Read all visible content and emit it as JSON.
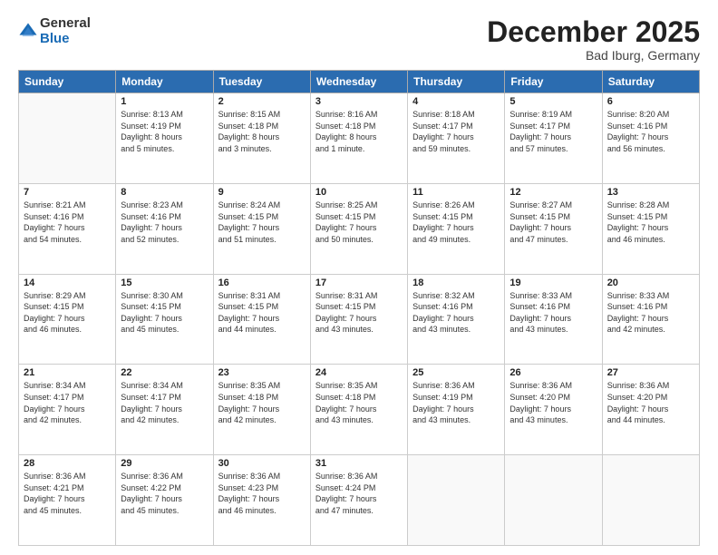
{
  "header": {
    "logo_general": "General",
    "logo_blue": "Blue",
    "month_title": "December 2025",
    "subtitle": "Bad Iburg, Germany"
  },
  "days_of_week": [
    "Sunday",
    "Monday",
    "Tuesday",
    "Wednesday",
    "Thursday",
    "Friday",
    "Saturday"
  ],
  "weeks": [
    [
      {
        "day": "",
        "info": ""
      },
      {
        "day": "1",
        "info": "Sunrise: 8:13 AM\nSunset: 4:19 PM\nDaylight: 8 hours\nand 5 minutes."
      },
      {
        "day": "2",
        "info": "Sunrise: 8:15 AM\nSunset: 4:18 PM\nDaylight: 8 hours\nand 3 minutes."
      },
      {
        "day": "3",
        "info": "Sunrise: 8:16 AM\nSunset: 4:18 PM\nDaylight: 8 hours\nand 1 minute."
      },
      {
        "day": "4",
        "info": "Sunrise: 8:18 AM\nSunset: 4:17 PM\nDaylight: 7 hours\nand 59 minutes."
      },
      {
        "day": "5",
        "info": "Sunrise: 8:19 AM\nSunset: 4:17 PM\nDaylight: 7 hours\nand 57 minutes."
      },
      {
        "day": "6",
        "info": "Sunrise: 8:20 AM\nSunset: 4:16 PM\nDaylight: 7 hours\nand 56 minutes."
      }
    ],
    [
      {
        "day": "7",
        "info": "Sunrise: 8:21 AM\nSunset: 4:16 PM\nDaylight: 7 hours\nand 54 minutes."
      },
      {
        "day": "8",
        "info": "Sunrise: 8:23 AM\nSunset: 4:16 PM\nDaylight: 7 hours\nand 52 minutes."
      },
      {
        "day": "9",
        "info": "Sunrise: 8:24 AM\nSunset: 4:15 PM\nDaylight: 7 hours\nand 51 minutes."
      },
      {
        "day": "10",
        "info": "Sunrise: 8:25 AM\nSunset: 4:15 PM\nDaylight: 7 hours\nand 50 minutes."
      },
      {
        "day": "11",
        "info": "Sunrise: 8:26 AM\nSunset: 4:15 PM\nDaylight: 7 hours\nand 49 minutes."
      },
      {
        "day": "12",
        "info": "Sunrise: 8:27 AM\nSunset: 4:15 PM\nDaylight: 7 hours\nand 47 minutes."
      },
      {
        "day": "13",
        "info": "Sunrise: 8:28 AM\nSunset: 4:15 PM\nDaylight: 7 hours\nand 46 minutes."
      }
    ],
    [
      {
        "day": "14",
        "info": "Sunrise: 8:29 AM\nSunset: 4:15 PM\nDaylight: 7 hours\nand 46 minutes."
      },
      {
        "day": "15",
        "info": "Sunrise: 8:30 AM\nSunset: 4:15 PM\nDaylight: 7 hours\nand 45 minutes."
      },
      {
        "day": "16",
        "info": "Sunrise: 8:31 AM\nSunset: 4:15 PM\nDaylight: 7 hours\nand 44 minutes."
      },
      {
        "day": "17",
        "info": "Sunrise: 8:31 AM\nSunset: 4:15 PM\nDaylight: 7 hours\nand 43 minutes."
      },
      {
        "day": "18",
        "info": "Sunrise: 8:32 AM\nSunset: 4:16 PM\nDaylight: 7 hours\nand 43 minutes."
      },
      {
        "day": "19",
        "info": "Sunrise: 8:33 AM\nSunset: 4:16 PM\nDaylight: 7 hours\nand 43 minutes."
      },
      {
        "day": "20",
        "info": "Sunrise: 8:33 AM\nSunset: 4:16 PM\nDaylight: 7 hours\nand 42 minutes."
      }
    ],
    [
      {
        "day": "21",
        "info": "Sunrise: 8:34 AM\nSunset: 4:17 PM\nDaylight: 7 hours\nand 42 minutes."
      },
      {
        "day": "22",
        "info": "Sunrise: 8:34 AM\nSunset: 4:17 PM\nDaylight: 7 hours\nand 42 minutes."
      },
      {
        "day": "23",
        "info": "Sunrise: 8:35 AM\nSunset: 4:18 PM\nDaylight: 7 hours\nand 42 minutes."
      },
      {
        "day": "24",
        "info": "Sunrise: 8:35 AM\nSunset: 4:18 PM\nDaylight: 7 hours\nand 43 minutes."
      },
      {
        "day": "25",
        "info": "Sunrise: 8:36 AM\nSunset: 4:19 PM\nDaylight: 7 hours\nand 43 minutes."
      },
      {
        "day": "26",
        "info": "Sunrise: 8:36 AM\nSunset: 4:20 PM\nDaylight: 7 hours\nand 43 minutes."
      },
      {
        "day": "27",
        "info": "Sunrise: 8:36 AM\nSunset: 4:20 PM\nDaylight: 7 hours\nand 44 minutes."
      }
    ],
    [
      {
        "day": "28",
        "info": "Sunrise: 8:36 AM\nSunset: 4:21 PM\nDaylight: 7 hours\nand 45 minutes."
      },
      {
        "day": "29",
        "info": "Sunrise: 8:36 AM\nSunset: 4:22 PM\nDaylight: 7 hours\nand 45 minutes."
      },
      {
        "day": "30",
        "info": "Sunrise: 8:36 AM\nSunset: 4:23 PM\nDaylight: 7 hours\nand 46 minutes."
      },
      {
        "day": "31",
        "info": "Sunrise: 8:36 AM\nSunset: 4:24 PM\nDaylight: 7 hours\nand 47 minutes."
      },
      {
        "day": "",
        "info": ""
      },
      {
        "day": "",
        "info": ""
      },
      {
        "day": "",
        "info": ""
      }
    ]
  ]
}
